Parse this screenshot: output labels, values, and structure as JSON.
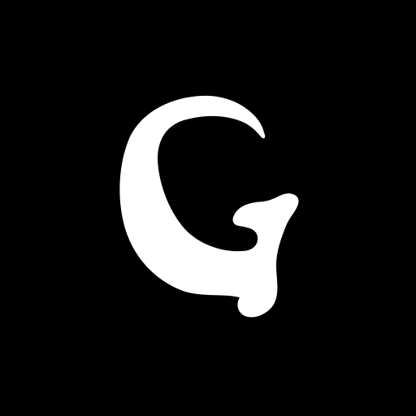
{
  "logo": {
    "letter": "G",
    "icon": "g-letter-logo-icon",
    "colors": {
      "background": "#000000",
      "glyph": "#ffffff"
    }
  }
}
